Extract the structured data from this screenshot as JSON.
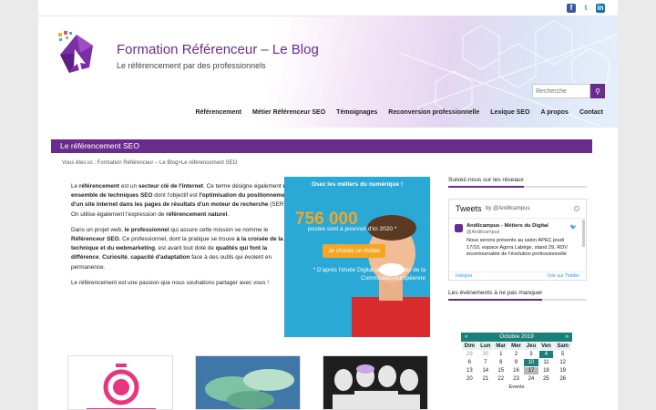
{
  "social": {
    "icons": [
      "facebook-icon",
      "twitter-icon",
      "linkedin-icon"
    ]
  },
  "header": {
    "site_title": "Formation Référenceur – Le Blog",
    "site_description": "Le référencement par des professionnels",
    "search_placeholder": "Recherche"
  },
  "nav": {
    "items": [
      "Référencement",
      "Métier Référenceur SEO",
      "Témoignages",
      "Reconversion professionnelle",
      "Lexique SEO",
      "A propos",
      "Contact"
    ]
  },
  "page": {
    "title": "Le référencement SEO",
    "breadcrumb": "Vous êtes ici : Formation Référenceur – Le Blog>Le référencement SEO"
  },
  "content": {
    "p1_parts": [
      "Le ",
      "référencement",
      " est un ",
      "secteur clé de l'internet",
      ". Ce terme désigne également ",
      "un ensemble de techniques SEO",
      " dont l'objectif est ",
      "l'optimisation du positionnement d'un site internet dans les pages de résultats d'un moteur de recherche",
      " (SERPs). On utilise également l'expression de ",
      "référencement naturel",
      "."
    ],
    "p2_parts": [
      "Dans un projet web, ",
      "le professionnel",
      " qui assure cette mission se nomme le ",
      "Référenceur SEO",
      ". Ce professionnel, dont la pratique se trouve ",
      "à la croisée de la technique et du webmarketing",
      ", est avant tout doté de ",
      "qualités qui font la différence",
      ". ",
      "Curiosité",
      ", ",
      "capacité d'adaptation",
      " face à des outils qui évolent en permanence."
    ],
    "p3": "Le référencement est une passion que nous souhaitons partager avec vous !"
  },
  "promo": {
    "headline": "Osez les métiers du numérique !",
    "number": "756 000",
    "subline": "postes sont à pourvoir d'ici 2020 *",
    "cta_label": "Je choisis un métier",
    "note": "* D'après l'étude Digital skills and jobs de la Commission européenne"
  },
  "sidebar": {
    "social_title": "Suivez-nous sur les réseaux",
    "tweets": {
      "title": "Tweets",
      "by": "by @Andilcampus",
      "author": "Andilcampus - Métiers du Digital",
      "handle": "@Andilcampus",
      "body": "Nous serons présents au salon APEC jeudi 17/10, espace Agora Labège, stand 29, RDV incontournable de l'évolution professionnelle",
      "embed": "Intégrer",
      "view": "Voir sur Twitter"
    },
    "events_title": "Les événements à ne pas manquer",
    "calendar": {
      "month": "Octobre 2019",
      "prev": "«",
      "next": "»",
      "days": [
        "Dim",
        "Lun",
        "Mar",
        "Mer",
        "Jeu",
        "Ven",
        "Sam"
      ],
      "weeks": [
        [
          "29",
          "30",
          "1",
          "2",
          "3",
          "4",
          "5"
        ],
        [
          "6",
          "7",
          "8",
          "9",
          "10",
          "11",
          "12"
        ],
        [
          "13",
          "14",
          "15",
          "16",
          "17",
          "18",
          "19"
        ],
        [
          "20",
          "21",
          "22",
          "23",
          "24",
          "25",
          "26"
        ]
      ],
      "events_label": "Events"
    }
  },
  "colors": {
    "brand": "#6a2c8c",
    "promo_bg": "#2aa8d6",
    "cta": "#f5a623",
    "calendar": "#1b7f7a"
  }
}
